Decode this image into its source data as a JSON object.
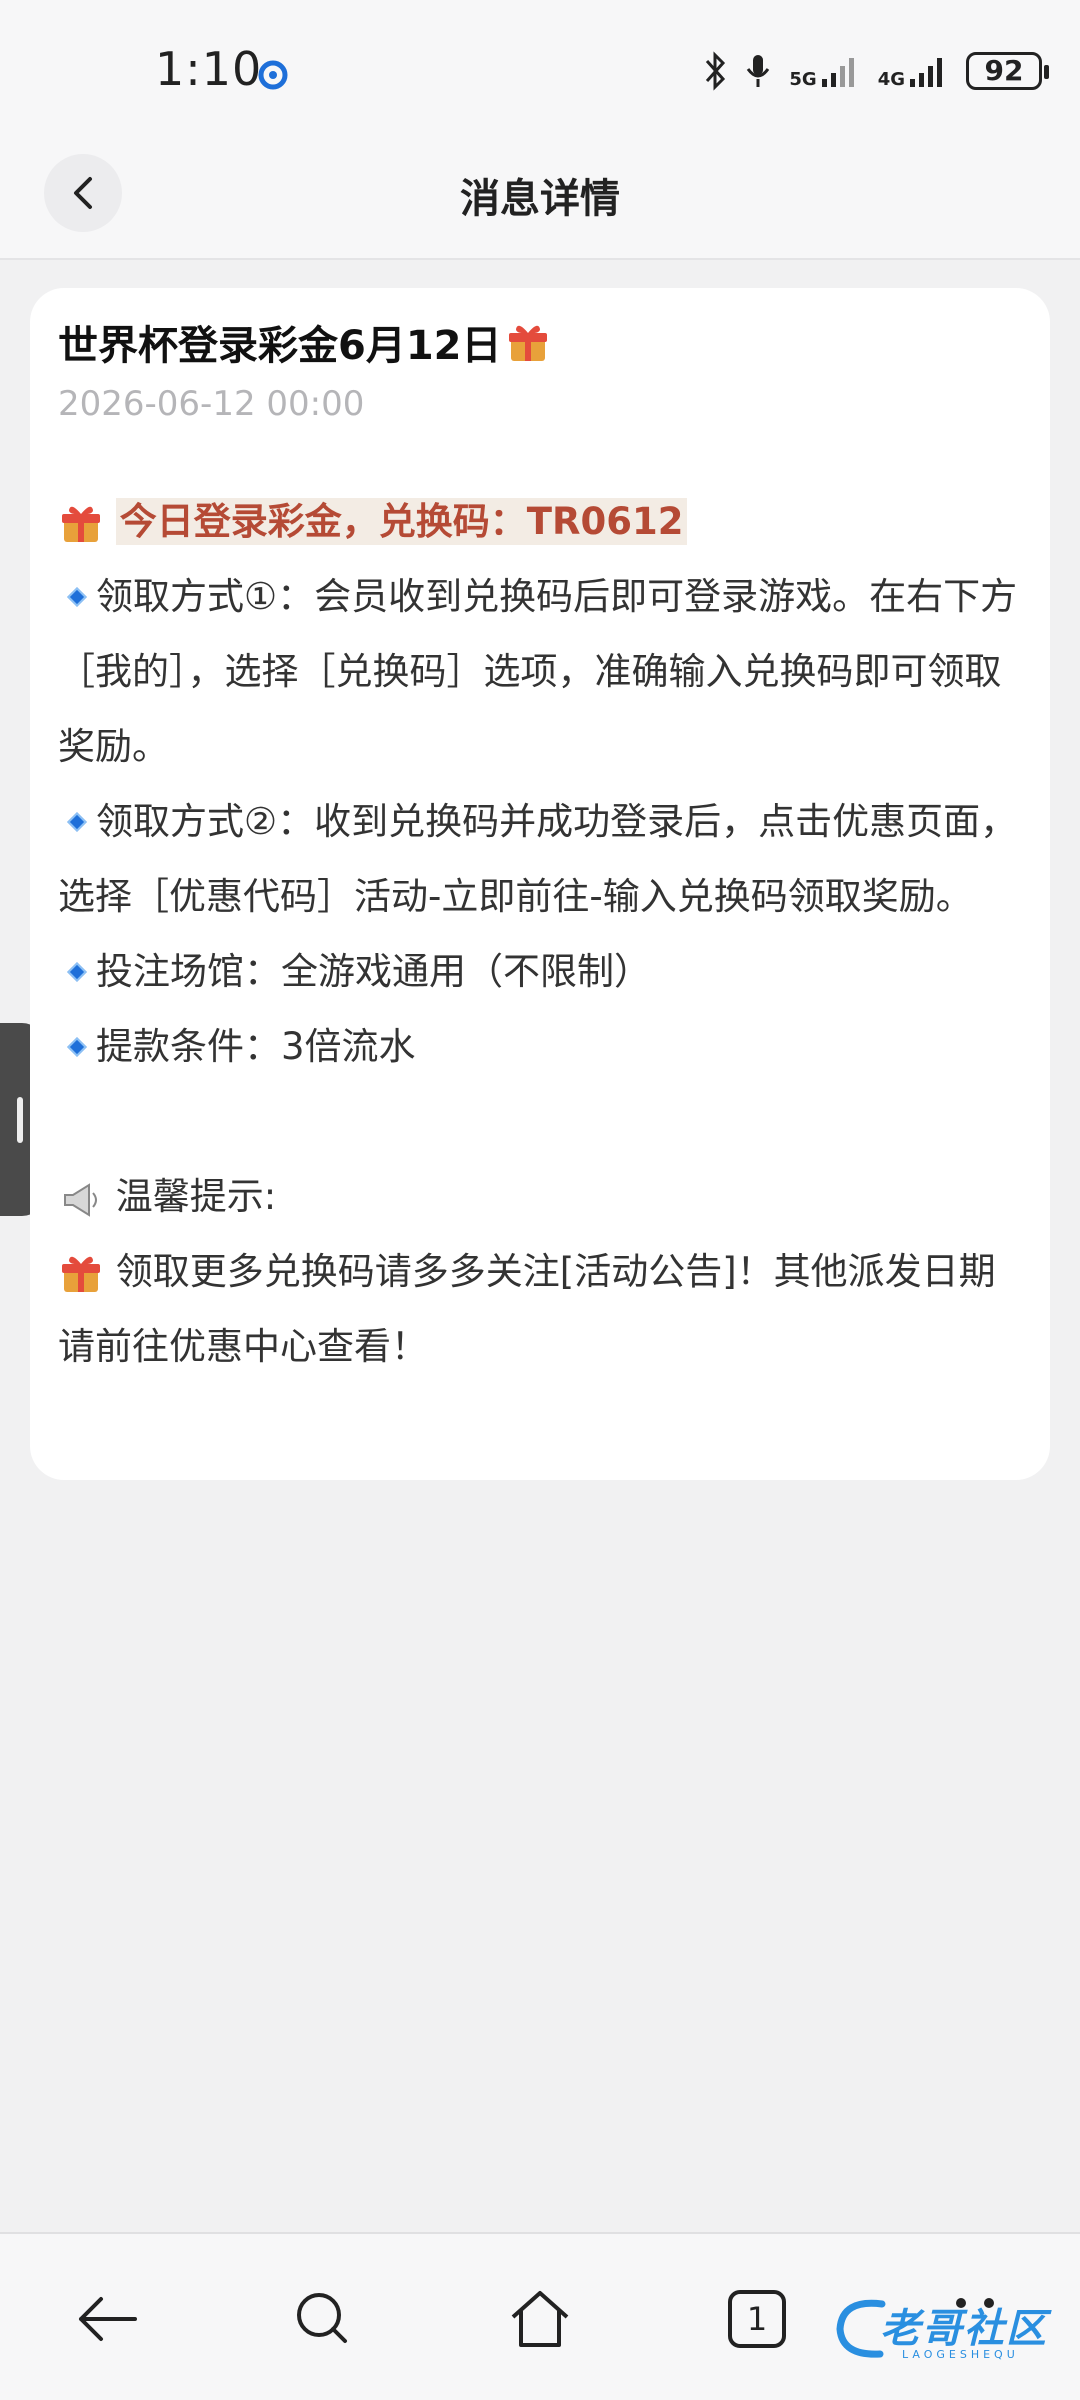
{
  "status_bar": {
    "time": "1:10",
    "network_1": "5G",
    "network_2": "4G",
    "battery": "92"
  },
  "header": {
    "title": "消息详情"
  },
  "message": {
    "title": "世界杯登录彩金6月12日",
    "date": "2026-06-12 00:00",
    "highlight": "今日登录彩金，兑换码：TR0612",
    "method1": "领取方式①：会员收到兑换码后即可登录游戏。在右下方［我的］，选择［兑换码］选项，准确输入兑换码即可领取奖励。",
    "method2": "领取方式②：收到兑换码并成功登录后，点击优惠页面，选择［优惠代码］活动-立即前往-输入兑换码领取奖励。",
    "venue": "投注场馆：全游戏通用（不限制）",
    "withdraw": "提款条件：3倍流水",
    "tip_title": "温馨提示:",
    "tip_text": "领取更多兑换码请多多关注[活动公告]！其他派发日期请前往优惠中心查看！"
  },
  "bottom_nav": {
    "tabs_count": "1"
  },
  "watermark": {
    "text": "老哥社区",
    "sub": "LAOGESHEQU"
  },
  "colors": {
    "highlight_text": "#b54a35",
    "highlight_bg": "#f3ece4",
    "bullet": "#1e6fd9"
  }
}
